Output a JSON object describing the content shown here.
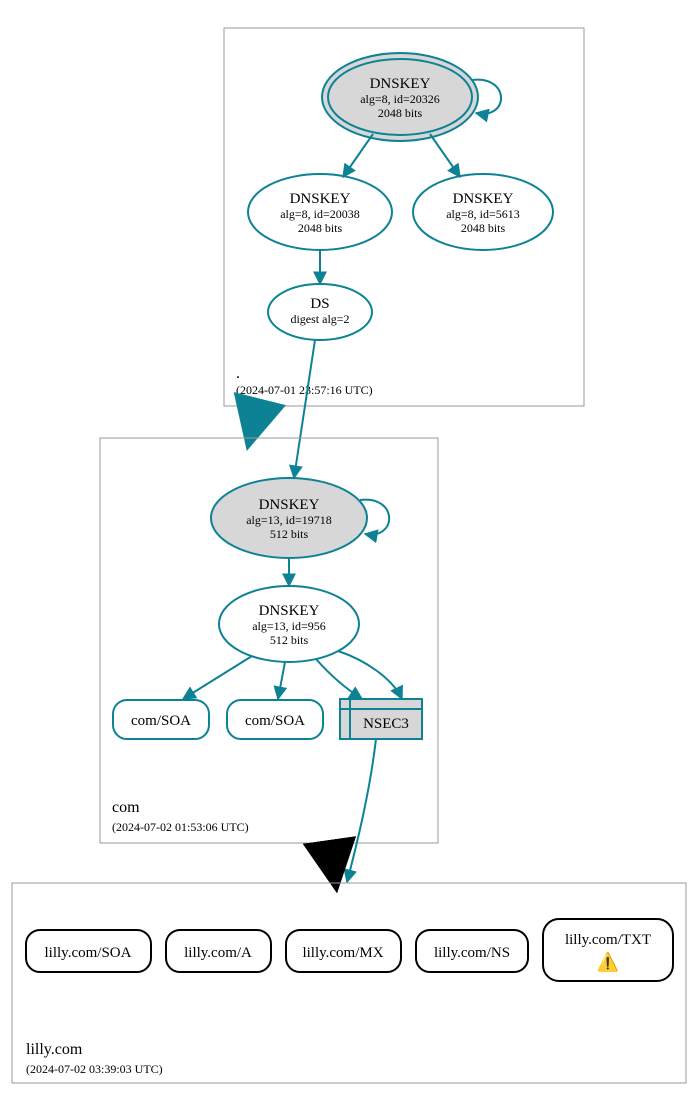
{
  "colors": {
    "teal": "#0d8295",
    "black": "#000000",
    "grayFill": "#d7d7d7",
    "lightGray": "#d7d7d7",
    "box": "#9a9a9a"
  },
  "zones": {
    "root": {
      "label": ".",
      "timestamp": "(2024-07-01 23:57:16 UTC)"
    },
    "com": {
      "label": "com",
      "timestamp": "(2024-07-02 01:53:06 UTC)"
    },
    "lilly": {
      "label": "lilly.com",
      "timestamp": "(2024-07-02 03:39:03 UTC)"
    }
  },
  "root_nodes": {
    "ksk": {
      "title": "DNSKEY",
      "line2": "alg=8, id=20326",
      "line3": "2048 bits"
    },
    "zsk1": {
      "title": "DNSKEY",
      "line2": "alg=8, id=20038",
      "line3": "2048 bits"
    },
    "zsk2": {
      "title": "DNSKEY",
      "line2": "alg=8, id=5613",
      "line3": "2048 bits"
    },
    "ds": {
      "title": "DS",
      "line2": "digest alg=2"
    }
  },
  "com_nodes": {
    "ksk": {
      "title": "DNSKEY",
      "line2": "alg=13, id=19718",
      "line3": "512 bits"
    },
    "zsk": {
      "title": "DNSKEY",
      "line2": "alg=13, id=956",
      "line3": "512 bits"
    },
    "soa1": "com/SOA",
    "soa2": "com/SOA",
    "nsec3": "NSEC3"
  },
  "lilly_nodes": {
    "soa": "lilly.com/SOA",
    "a": "lilly.com/A",
    "mx": "lilly.com/MX",
    "ns": "lilly.com/NS",
    "txt": "lilly.com/TXT",
    "warn": "⚠️"
  }
}
